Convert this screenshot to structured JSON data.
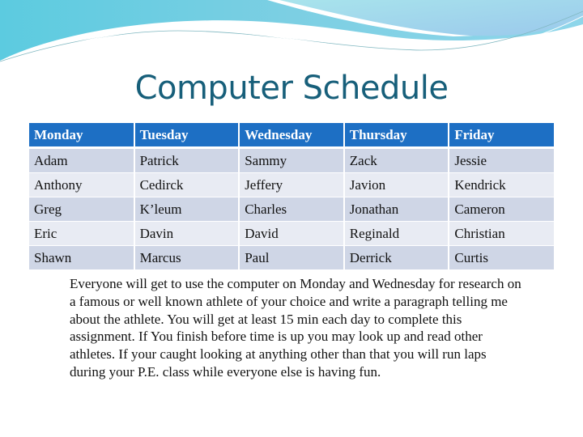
{
  "slide": {
    "title": "Computer Schedule",
    "colors": {
      "header": "#1d6fc4",
      "title": "#175f7a",
      "row_dark": "#cfd6e6",
      "row_light": "#e8ebf3"
    }
  },
  "table": {
    "headers": [
      "Monday",
      "Tuesday",
      "Wednesday",
      "Thursday",
      "Friday"
    ],
    "rows": [
      [
        "Adam",
        "Patrick",
        "Sammy",
        "Zack",
        "Jessie"
      ],
      [
        "Anthony",
        "Cedirck",
        "Jeffery",
        "Javion",
        "Kendrick"
      ],
      [
        "Greg",
        "K’leum",
        "Charles",
        "Jonathan",
        "Cameron"
      ],
      [
        "Eric",
        "Davin",
        "David",
        "Reginald",
        "Christian"
      ],
      [
        "Shawn",
        "Marcus",
        "Paul",
        "Derrick",
        "Curtis"
      ]
    ]
  },
  "note": "Everyone will get to use the computer on Monday and Wednesday for research on a famous or well known athlete of your choice and write a paragraph telling me about the athlete. You will get at least 15 min each day to complete this assignment. If You finish before time is up you may look up and read other athletes. If your caught looking at anything other than that you will run laps during your P.E. class while everyone else is having fun."
}
